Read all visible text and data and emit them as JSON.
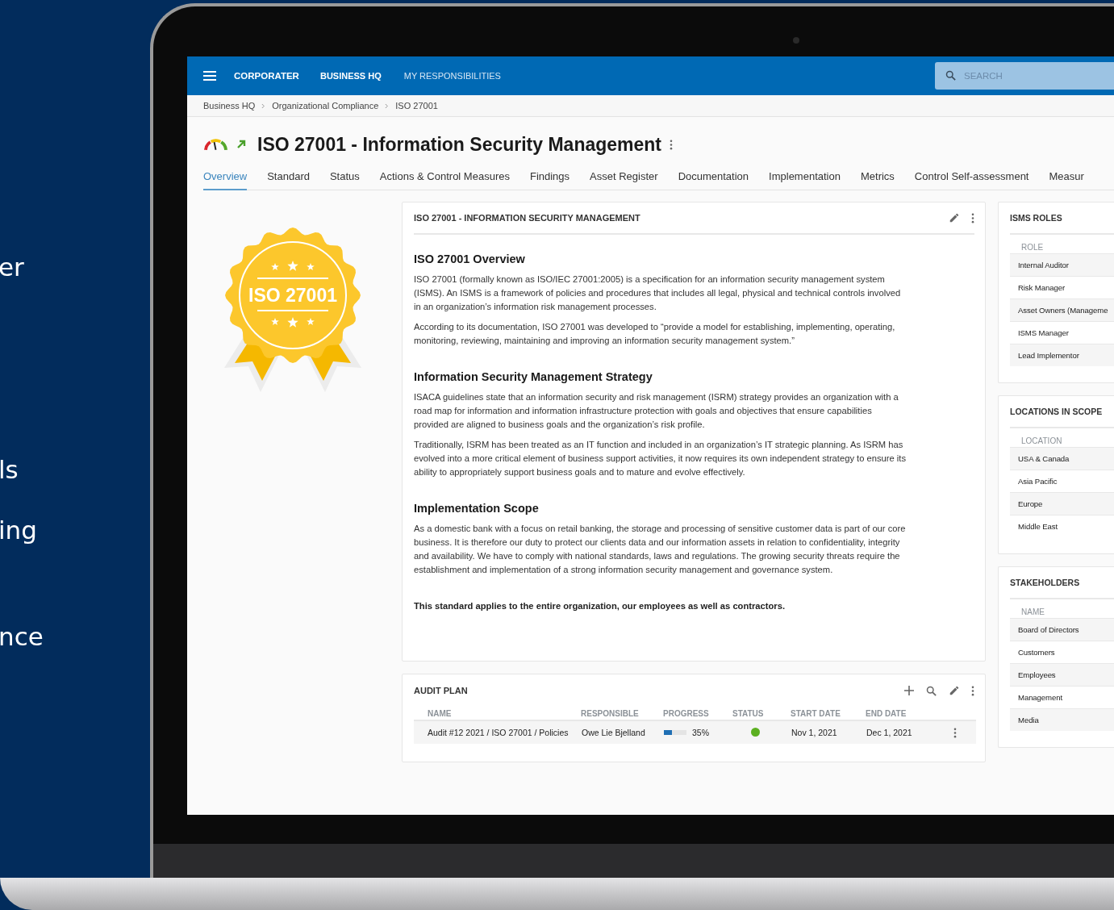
{
  "marketing_text": [
    "er",
    "ls",
    "ing",
    "nce"
  ],
  "topbar": {
    "brand": "CORPORATER",
    "nav": [
      {
        "label": "BUSINESS HQ"
      },
      {
        "label": "MY RESPONSIBILITIES"
      }
    ],
    "search": {
      "placeholder": "SEARCH"
    }
  },
  "breadcrumb": [
    "Business HQ",
    "Organizational Compliance",
    "ISO 27001"
  ],
  "page": {
    "title": "ISO 27001 - Information Security Management"
  },
  "tabs": [
    {
      "label": "Overview",
      "selected": true
    },
    {
      "label": "Standard",
      "selected": false
    },
    {
      "label": "Status",
      "selected": false
    },
    {
      "label": "Actions & Control Measures",
      "selected": false
    },
    {
      "label": "Findings",
      "selected": false
    },
    {
      "label": "Asset Register",
      "selected": false
    },
    {
      "label": "Documentation",
      "selected": false
    },
    {
      "label": "Implementation",
      "selected": false
    },
    {
      "label": "Metrics",
      "selected": false
    },
    {
      "label": "Control Self-assessment",
      "selected": false
    },
    {
      "label": "Measur",
      "selected": false
    }
  ],
  "badge": {
    "label": "ISO 27001"
  },
  "overview_card": {
    "title": "ISO 27001 - INFORMATION SECURITY MANAGEMENT",
    "sections": [
      {
        "heading": "ISO 27001 Overview",
        "paragraphs": [
          "ISO 27001 (formally known as ISO/IEC 27001:2005) is a specification for an information security management system (ISMS). An ISMS is a framework of policies and procedures that includes all legal, physical and technical controls involved in an organization’s information risk management processes.",
          "According to its documentation, ISO 27001 was developed to “provide a model for establishing, implementing, operating, monitoring, reviewing, maintaining and improving an information security management system.”"
        ]
      },
      {
        "heading": "Information Security Management Strategy",
        "paragraphs": [
          "ISACA guidelines state that an information security and risk management (ISRM) strategy provides an organization with a road map for information and information infrastructure protection with goals and objectives that ensure capabilities provided are aligned to business goals and the organization’s risk profile.",
          "Traditionally, ISRM has been treated as an IT function and included in an organization’s IT strategic planning. As ISRM has evolved into a more critical element of business support activities, it now requires its own independent strategy to ensure its ability to appropriately support business goals and to mature and evolve effectively."
        ]
      },
      {
        "heading": "Implementation Scope",
        "paragraphs": [
          "As a domestic bank with a focus on retail banking, the storage and processing of sensitive customer data is part of our core business. It is therefore our duty to protect our clients data and our information assets in relation to confidentiality, integrity and availability. We have to comply with national standards, laws and regulations. The growing security threats require the establishment and implementation of a strong information security management and governance system."
        ]
      }
    ],
    "note": "This standard applies to the entire organization, our employees as well as contractors."
  },
  "audit_plan": {
    "title": "AUDIT PLAN",
    "columns": [
      "NAME",
      "RESPONSIBLE",
      "PROGRESS",
      "STATUS",
      "START DATE",
      "END DATE"
    ],
    "rows": [
      {
        "name": "Audit #12 2021 / ISO 27001 / Policies",
        "responsible": "Owe Lie Bjelland",
        "level": 0.35,
        "progress": "35%",
        "color": "#5cb021",
        "start_date": "Nov 1, 2021",
        "end_date": "Dec 1, 2021"
      }
    ]
  },
  "side_panels": [
    {
      "title": "ISMS ROLES",
      "column": "ROLE",
      "rows": [
        "Internal Auditor",
        "Risk Manager",
        "Asset Owners (Manageme",
        "ISMS Manager",
        "Lead Implementor"
      ]
    },
    {
      "title": "LOCATIONS IN SCOPE",
      "column": "LOCATION",
      "rows": [
        "USA & Canada",
        "Asia Pacific",
        "Europe",
        "Middle East"
      ]
    },
    {
      "title": "STAKEHOLDERS",
      "column": "NAME",
      "rows": [
        "Board of Directors",
        "Customers",
        "Employees",
        "Management",
        "Media"
      ]
    }
  ]
}
